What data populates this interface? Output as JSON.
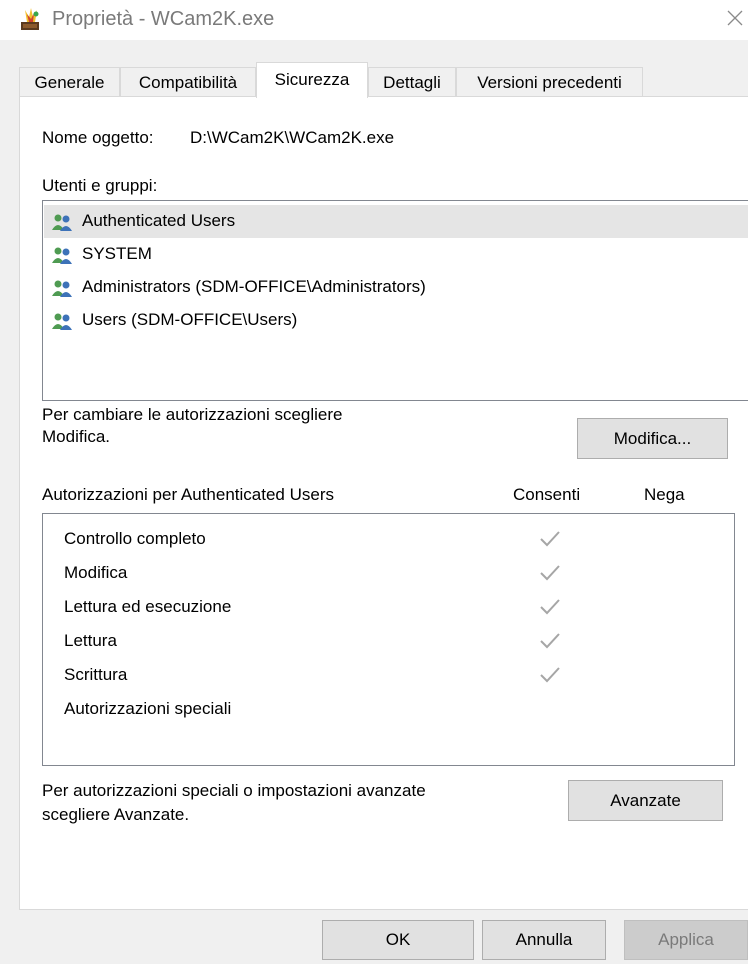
{
  "window": {
    "title": "Proprietà - WCam2K.exe",
    "icons": {
      "app": "properties-icon",
      "close": "close-icon"
    }
  },
  "tabs": [
    {
      "label": "Generale",
      "active": false
    },
    {
      "label": "Compatibilità",
      "active": false
    },
    {
      "label": "Sicurezza",
      "active": true
    },
    {
      "label": "Dettagli",
      "active": false
    },
    {
      "label": "Versioni precedenti",
      "active": false
    }
  ],
  "security": {
    "object_name_label": "Nome oggetto:",
    "object_name_value": "D:\\WCam2K\\WCam2K.exe",
    "groups_label": "Utenti e gruppi:",
    "groups": [
      {
        "label": "Authenticated Users",
        "icon": "users-group-icon",
        "selected": true
      },
      {
        "label": "SYSTEM",
        "icon": "users-group-icon",
        "selected": false
      },
      {
        "label": "Administrators (SDM-OFFICE\\Administrators)",
        "icon": "users-group-icon",
        "selected": false
      },
      {
        "label": "Users (SDM-OFFICE\\Users)",
        "icon": "users-group-icon",
        "selected": false
      }
    ],
    "change_hint_line1": "Per cambiare le autorizzazioni scegliere",
    "change_hint_line2": "Modifica.",
    "edit_button": "Modifica...",
    "permissions_header": "Autorizzazioni per Authenticated Users",
    "allow_header": "Consenti",
    "deny_header": "Nega",
    "permissions": [
      {
        "label": "Controllo completo",
        "allow": true,
        "deny": false
      },
      {
        "label": "Modifica",
        "allow": true,
        "deny": false
      },
      {
        "label": "Lettura ed esecuzione",
        "allow": true,
        "deny": false
      },
      {
        "label": "Lettura",
        "allow": true,
        "deny": false
      },
      {
        "label": "Scrittura",
        "allow": true,
        "deny": false
      },
      {
        "label": "Autorizzazioni speciali",
        "allow": false,
        "deny": false
      }
    ],
    "advanced_hint_line1": "Per autorizzazioni speciali o impostazioni avanzate",
    "advanced_hint_line2": "scegliere Avanzate.",
    "advanced_button": "Avanzate"
  },
  "footer": {
    "ok": "OK",
    "cancel": "Annulla",
    "apply": "Applica",
    "apply_enabled": false
  },
  "colors": {
    "dialog_bg": "#f0f0f0",
    "selection": "#e5e5e5",
    "check": "#a6a6a6"
  }
}
